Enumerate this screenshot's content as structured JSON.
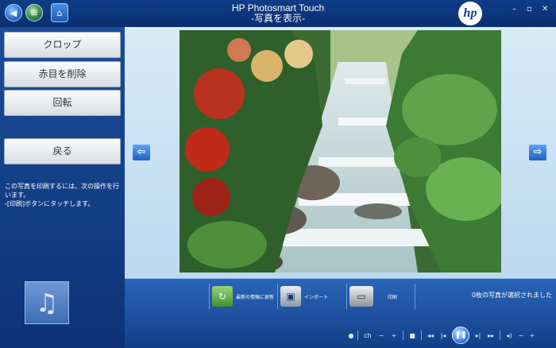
{
  "titlebar": {
    "app_name": "HP Photosmart Touch",
    "subtitle": "-写真を表示-",
    "logo_text": "hp",
    "minimize_glyph": "–",
    "maximize_glyph": "▫",
    "close_glyph": "✕",
    "icons": [
      "back-icon",
      "windows-start-icon",
      "home-icon"
    ]
  },
  "actions": {
    "crop": "クロップ",
    "red_eye": "赤目を削除",
    "rotate": "回転",
    "back": "戻る"
  },
  "instructions": {
    "line1": "この写真を印刷するには、次の操作を行います。",
    "line2": "-[印刷]ボタンにタッチします。"
  },
  "music": {
    "icon": "music-note-icon",
    "glyph": "♫"
  },
  "navigation": {
    "prev_glyph": "⇦",
    "next_glyph": "⇨"
  },
  "toolbar": {
    "refresh_label": "最新の情報に更新",
    "import_label": "インポート",
    "print_label": "印刷",
    "status": "0枚の写真が選択されました"
  },
  "media": {
    "channel": "ch",
    "dot": "●",
    "minus": "−",
    "plus": "+",
    "stop": "■",
    "rewind": "◂◂",
    "previous": "|◂",
    "play": "❚❚",
    "next": "▸|",
    "forward": "▸▸",
    "volume": "◂)",
    "vol_down": "−",
    "vol_up": "+"
  },
  "colors": {
    "titlebar": "#0f3c88",
    "panel": "#1a4d97",
    "main_bg": "#d7ebf8",
    "button_face": "#f2f3f5"
  }
}
